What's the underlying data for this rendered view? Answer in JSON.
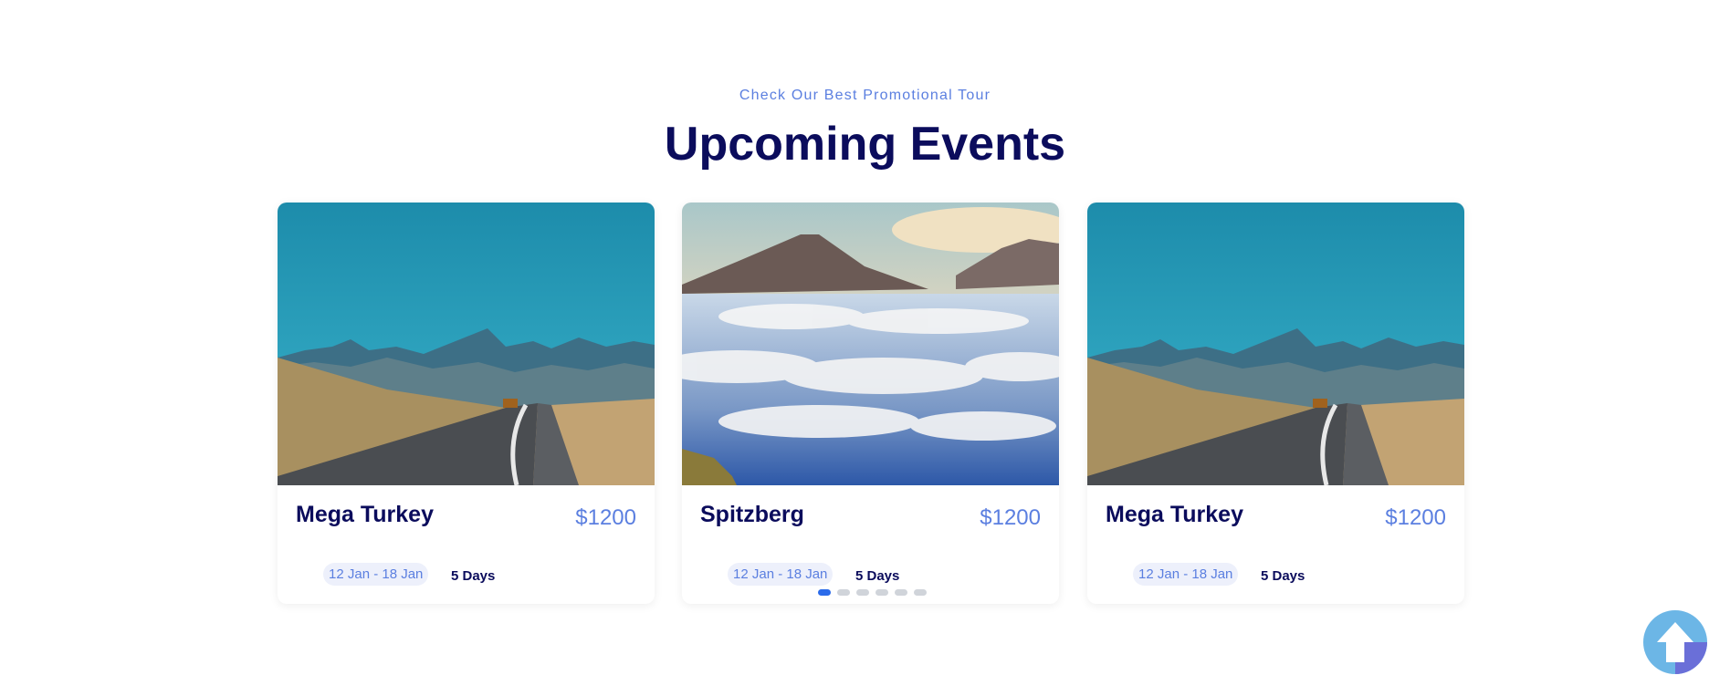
{
  "section": {
    "subtitle": "Check Our Best Promotional Tour",
    "title": "Upcoming Events"
  },
  "cards": [
    {
      "title": "Mega Turkey",
      "price": "$1200",
      "dates": "12 Jan - 18 Jan",
      "duration": "5 Days",
      "image": "desert-road-mountains"
    },
    {
      "title": "Spitzberg",
      "price": "$1200",
      "dates": "12 Jan - 18 Jan",
      "duration": "5 Days",
      "image": "volcano-above-clouds"
    },
    {
      "title": "Mega Turkey",
      "price": "$1200",
      "dates": "12 Jan - 18 Jan",
      "duration": "5 Days",
      "image": "desert-road-mountains"
    }
  ],
  "carousel": {
    "slide_count": 6,
    "active_index": 0
  },
  "scroll_top": {
    "icon": "arrow-up-icon"
  },
  "colors": {
    "accent": "#5b7fe0",
    "heading": "#0b0c5c",
    "dot_active": "#2b6bea",
    "dot_inactive": "#d0d4da"
  }
}
